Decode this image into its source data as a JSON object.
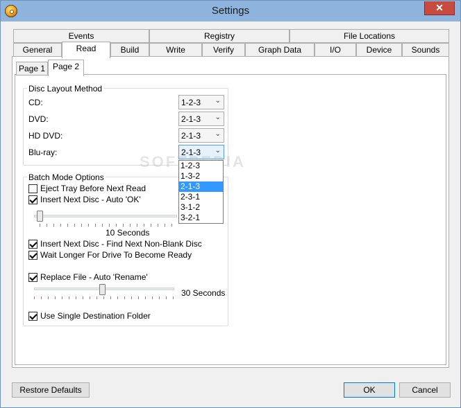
{
  "window": {
    "title": "Settings",
    "close_glyph": "✕"
  },
  "tabs_top": [
    "Events",
    "Registry",
    "File Locations"
  ],
  "tabs_bottom": [
    "General",
    "Read",
    "Build",
    "Write",
    "Verify",
    "Graph Data",
    "I/O",
    "Device",
    "Sounds"
  ],
  "subtabs": [
    "Page 1",
    "Page 2"
  ],
  "disc_layout": {
    "title": "Disc Layout Method",
    "rows": [
      {
        "label": "CD:",
        "value": "1-2-3"
      },
      {
        "label": "DVD:",
        "value": "2-1-3"
      },
      {
        "label": "HD DVD:",
        "value": "2-1-3"
      },
      {
        "label": "Blu-ray:",
        "value": "2-1-3"
      }
    ],
    "dropdown_options": [
      "1-2-3",
      "1-3-2",
      "2-1-3",
      "2-3-1",
      "3-1-2",
      "3-2-1"
    ],
    "selected_option": "2-1-3"
  },
  "batch_mode": {
    "title": "Batch Mode Options",
    "eject_tray": {
      "label": "Eject Tray Before Next Read",
      "checked": false
    },
    "insert_auto_ok": {
      "label": "Insert Next Disc - Auto 'OK'",
      "checked": true
    },
    "auto_ok_seconds": "10 Seconds",
    "find_non_blank": {
      "label": "Insert Next Disc - Find Next Non-Blank Disc",
      "checked": true
    },
    "wait_longer": {
      "label": "Wait Longer For Drive To Become Ready",
      "checked": true
    },
    "replace_file": {
      "label": "Replace File - Auto 'Rename'",
      "checked": true
    },
    "rename_seconds": "30 Seconds",
    "single_folder": {
      "label": "Use Single Destination Folder",
      "checked": true
    }
  },
  "buttons": {
    "restore": "Restore Defaults",
    "ok": "OK",
    "cancel": "Cancel"
  },
  "watermark": "SOFTPEDIA",
  "colors": {
    "titlebar": "#8eb4de",
    "close": "#c74b3f",
    "selection": "#3399ff"
  }
}
